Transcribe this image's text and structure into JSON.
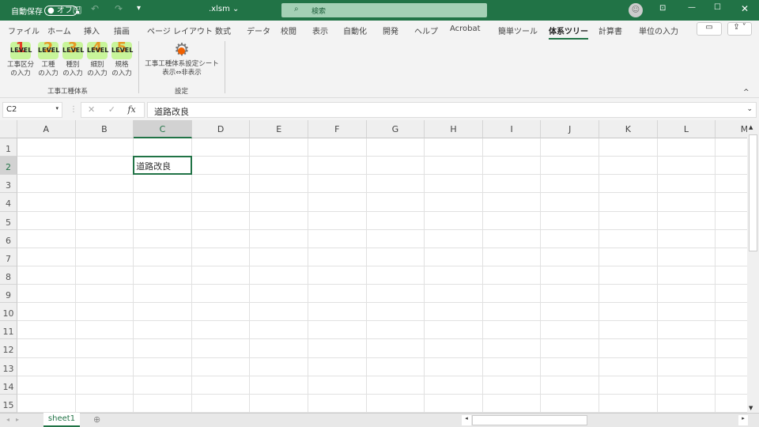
{
  "titlebar": {
    "autosave": "自動保存",
    "autosave_state": "オフ",
    "filename": ".xlsm ⌄",
    "search_placeholder": "検索"
  },
  "tabs": [
    "ファイル",
    "ホーム",
    "挿入",
    "描画",
    "ページ レイアウト",
    "数式",
    "データ",
    "校閲",
    "表示",
    "自動化",
    "開発",
    "ヘルプ",
    "Acrobat",
    "簡単ツール",
    "体系ツリー",
    "計算書",
    "単位の入力"
  ],
  "active_tab": "体系ツリー",
  "ribbon": {
    "level_text": "LEVEL",
    "buttons": [
      {
        "num": "1",
        "line1": "工事区分",
        "line2": "の入力"
      },
      {
        "num": "2",
        "line1": "工種",
        "line2": "の入力"
      },
      {
        "num": "3",
        "line1": "種別",
        "line2": "の入力"
      },
      {
        "num": "4",
        "line1": "細別",
        "line2": "の入力"
      },
      {
        "num": "5",
        "line1": "規格",
        "line2": "の入力"
      }
    ],
    "group1": "工事工種体系",
    "settings_line1": "工事工種体系設定シート",
    "settings_line2": "表示⇔非表示",
    "group2": "設定"
  },
  "formula": {
    "name_box": "C2",
    "fx": "fx",
    "cancel": "✕",
    "enter": "✓",
    "content": "道路改良"
  },
  "columns": [
    "A",
    "B",
    "C",
    "D",
    "E",
    "F",
    "G",
    "H",
    "I",
    "J",
    "K",
    "L",
    "M"
  ],
  "rows": [
    "1",
    "2",
    "3",
    "4",
    "5",
    "6",
    "7",
    "8",
    "9",
    "10",
    "11",
    "12",
    "13",
    "14",
    "15"
  ],
  "selected": {
    "col": "C",
    "row": "2",
    "value": "道路改良"
  },
  "sheets": [
    "sheet1"
  ],
  "colors": {
    "accent": "#217346"
  }
}
